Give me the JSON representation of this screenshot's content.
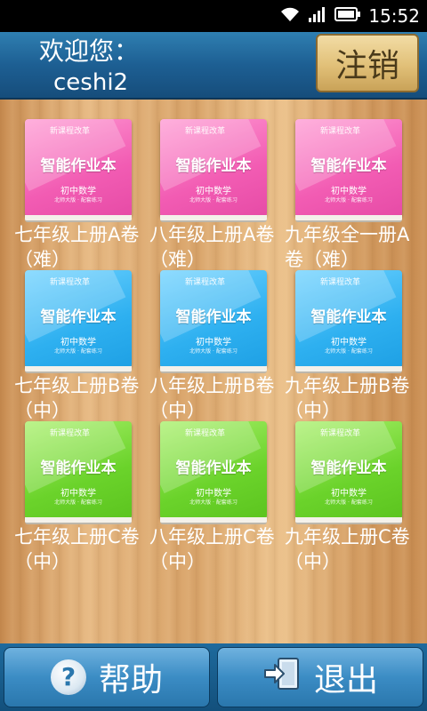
{
  "status_bar": {
    "time": "15:52"
  },
  "header": {
    "welcome": "欢迎您：",
    "username": "ceshi2",
    "logout_label": "注销"
  },
  "cover_text": {
    "logo": "新课程改革",
    "title": "智能作业本",
    "subject": "初中数学",
    "tiny": "北师大版 · 配套练习"
  },
  "books": [
    {
      "label": "七年级上册A卷（难）",
      "color": "pink"
    },
    {
      "label": "八年级上册A卷（难）",
      "color": "pink"
    },
    {
      "label": "九年级全一册A卷（难）",
      "color": "pink"
    },
    {
      "label": "七年级上册B卷（中）",
      "color": "blue"
    },
    {
      "label": "八年级上册B卷（中）",
      "color": "blue"
    },
    {
      "label": "九年级上册B卷（中）",
      "color": "blue"
    },
    {
      "label": "七年级上册C卷（中）",
      "color": "green"
    },
    {
      "label": "八年级上册C卷（中）",
      "color": "green"
    },
    {
      "label": "九年级上册C卷（中）",
      "color": "green"
    }
  ],
  "bottom_bar": {
    "help_label": "帮助",
    "exit_label": "退出"
  },
  "colors": {
    "header_blue": "#1d5f93",
    "logout_gold": "#e1c078",
    "wood": "#d9a46a"
  },
  "icons": [
    "wifi-icon",
    "signal-icon",
    "battery-icon",
    "help-icon",
    "exit-icon"
  ]
}
